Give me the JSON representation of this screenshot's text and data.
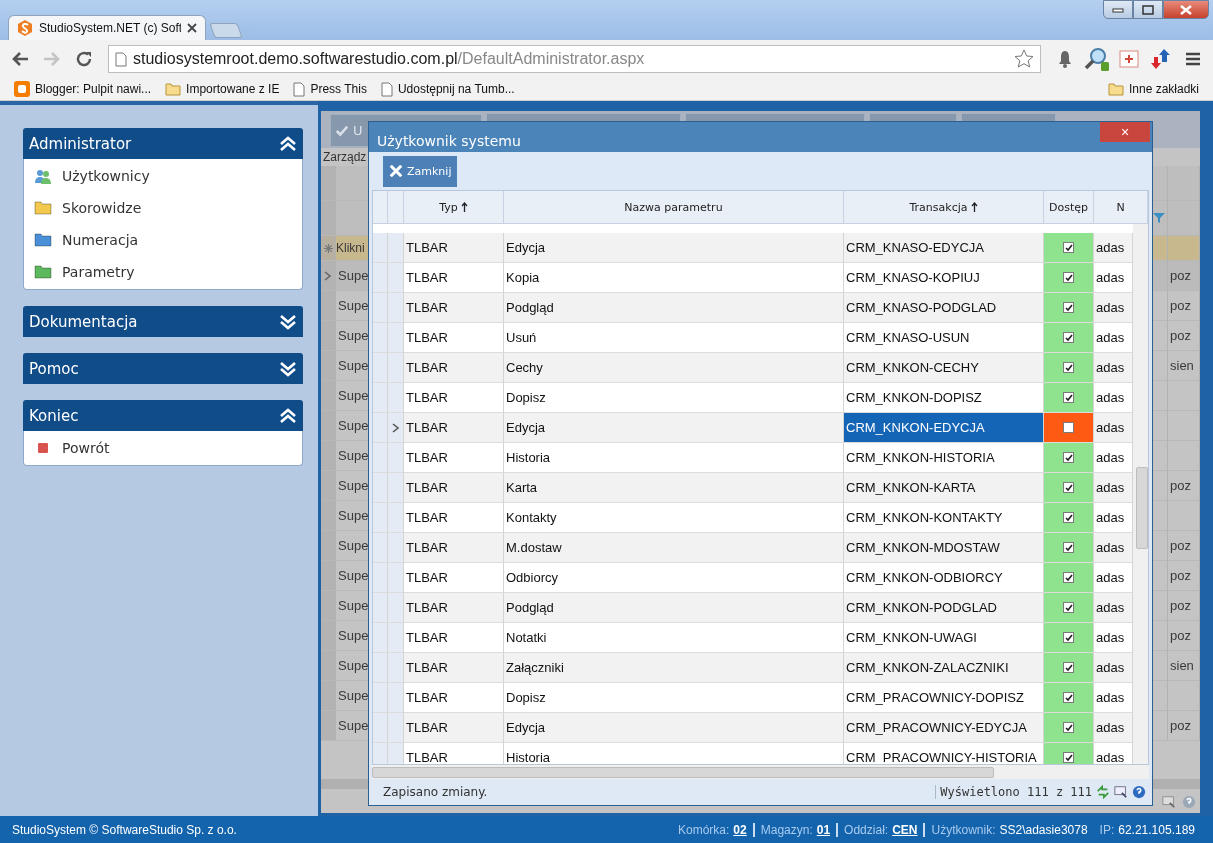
{
  "browser": {
    "tab_title": "StudioSystem.NET (c) Soft",
    "url_host": "studiosystemroot.demo.softwarestudio.com.pl",
    "url_path": "/DefaultAdministrator.aspx",
    "forward_disabled": true,
    "bookmarks": [
      {
        "label": "Blogger: Pulpit nawi...",
        "kind": "blogger"
      },
      {
        "label": "Importowane z IE",
        "kind": "folder"
      },
      {
        "label": "Press This",
        "kind": "page"
      },
      {
        "label": "Udostępnij na Tumb...",
        "kind": "page"
      }
    ],
    "other_bookmarks": "Inne zakładki"
  },
  "sidebar": {
    "panels": [
      {
        "title": "Administrator",
        "expanded": true,
        "items": [
          {
            "label": "Użytkownicy",
            "kind": "users"
          },
          {
            "label": "Skorowidze",
            "kind": "folder",
            "color": "#f2c94c"
          },
          {
            "label": "Numeracja",
            "kind": "folder",
            "color": "#4a90d9"
          },
          {
            "label": "Parametry",
            "kind": "folder",
            "color": "#5cb85c"
          }
        ]
      },
      {
        "title": "Dokumentacja",
        "expanded": false
      },
      {
        "title": "Pomoc",
        "expanded": false
      },
      {
        "title": "Koniec",
        "expanded": true,
        "items": [
          {
            "label": "Powrót",
            "kind": "square",
            "color": "#d9534f"
          }
        ]
      }
    ]
  },
  "background_grid": {
    "toolbar_button": "U",
    "section_label": "Zarządz",
    "new_row_hint": "Klikni",
    "rows": [
      {
        "column_1": "Supe",
        "column_2": "poz",
        "selected": true
      },
      {
        "column_1": "Supe",
        "column_2": "poz",
        "selected": false
      },
      {
        "column_1": "Supe",
        "column_2": "poz",
        "selected": false
      },
      {
        "column_1": "Supe",
        "column_2": "sien",
        "selected": false
      },
      {
        "column_1": "Supe",
        "selected": false
      },
      {
        "column_1": "Supe",
        "selected": false
      },
      {
        "column_1": "Supe",
        "selected": false
      },
      {
        "column_1": "Supe",
        "column_2": "poz",
        "selected": false
      },
      {
        "column_1": "Supe",
        "selected": false
      },
      {
        "column_1": "Supe",
        "column_2": "poz",
        "selected": false
      },
      {
        "column_1": "Supe",
        "column_2": "poz",
        "selected": false
      },
      {
        "column_1": "Supe",
        "column_2": "poz",
        "selected": false
      },
      {
        "column_1": "Supe",
        "column_2": "poz",
        "selected": false
      },
      {
        "column_1": "Supe",
        "column_2": "sien",
        "selected": false
      },
      {
        "column_1": "Supe",
        "selected": false
      },
      {
        "column_1": "Supe",
        "column_2": "poz",
        "selected": false
      }
    ]
  },
  "dialog": {
    "title": "Użytkownik systemu",
    "close_button": "×",
    "toolbar_button": "Zamknij",
    "columns": [
      {
        "label": "Typ",
        "sorted": true
      },
      {
        "label": "Nazwa parametru",
        "sorted": false
      },
      {
        "label": "Transakcja",
        "sorted": true
      },
      {
        "label": "Dostęp",
        "sorted": false
      },
      {
        "label": "N",
        "sorted": false
      }
    ],
    "rows": [
      {
        "typ": "TLBAR",
        "nazwa_parametru": "Edycja",
        "transakcja": "CRM_KNASO-EDYCJA",
        "dostep": true,
        "column_5": "adas",
        "selected": false
      },
      {
        "typ": "TLBAR",
        "nazwa_parametru": "Kopia",
        "transakcja": "CRM_KNASO-KOPIUJ",
        "dostep": true,
        "column_5": "adas",
        "selected": false
      },
      {
        "typ": "TLBAR",
        "nazwa_parametru": "Podgląd",
        "transakcja": "CRM_KNASO-PODGLAD",
        "dostep": true,
        "column_5": "adas",
        "selected": false
      },
      {
        "typ": "TLBAR",
        "nazwa_parametru": "Usuń",
        "transakcja": "CRM_KNASO-USUN",
        "dostep": true,
        "column_5": "adas",
        "selected": false
      },
      {
        "typ": "TLBAR",
        "nazwa_parametru": "Cechy",
        "transakcja": "CRM_KNKON-CECHY",
        "dostep": true,
        "column_5": "adas",
        "selected": false
      },
      {
        "typ": "TLBAR",
        "nazwa_parametru": "Dopisz",
        "transakcja": "CRM_KNKON-DOPISZ",
        "dostep": true,
        "column_5": "adas",
        "selected": false
      },
      {
        "typ": "TLBAR",
        "nazwa_parametru": "Edycja",
        "transakcja": "CRM_KNKON-EDYCJA",
        "dostep": false,
        "column_5": "adas",
        "selected": true
      },
      {
        "typ": "TLBAR",
        "nazwa_parametru": "Historia",
        "transakcja": "CRM_KNKON-HISTORIA",
        "dostep": true,
        "column_5": "adas",
        "selected": false
      },
      {
        "typ": "TLBAR",
        "nazwa_parametru": "Karta",
        "transakcja": "CRM_KNKON-KARTA",
        "dostep": true,
        "column_5": "adas",
        "selected": false
      },
      {
        "typ": "TLBAR",
        "nazwa_parametru": "Kontakty",
        "transakcja": "CRM_KNKON-KONTAKTY",
        "dostep": true,
        "column_5": "adas",
        "selected": false
      },
      {
        "typ": "TLBAR",
        "nazwa_parametru": "M.dostaw",
        "transakcja": "CRM_KNKON-MDOSTAW",
        "dostep": true,
        "column_5": "adas",
        "selected": false
      },
      {
        "typ": "TLBAR",
        "nazwa_parametru": "Odbiorcy",
        "transakcja": "CRM_KNKON-ODBIORCY",
        "dostep": true,
        "column_5": "adas",
        "selected": false
      },
      {
        "typ": "TLBAR",
        "nazwa_parametru": "Podgląd",
        "transakcja": "CRM_KNKON-PODGLAD",
        "dostep": true,
        "column_5": "adas",
        "selected": false
      },
      {
        "typ": "TLBAR",
        "nazwa_parametru": "Notatki",
        "transakcja": "CRM_KNKON-UWAGI",
        "dostep": true,
        "column_5": "adas",
        "selected": false
      },
      {
        "typ": "TLBAR",
        "nazwa_parametru": "Załączniki",
        "transakcja": "CRM_KNKON-ZALACZNIKI",
        "dostep": true,
        "column_5": "adas",
        "selected": false
      },
      {
        "typ": "TLBAR",
        "nazwa_parametru": "Dopisz",
        "transakcja": "CRM_PRACOWNICY-DOPISZ",
        "dostep": true,
        "column_5": "adas",
        "selected": false
      },
      {
        "typ": "TLBAR",
        "nazwa_parametru": "Edycja",
        "transakcja": "CRM_PRACOWNICY-EDYCJA",
        "dostep": true,
        "column_5": "adas",
        "selected": false
      },
      {
        "typ": "TLBAR",
        "nazwa_parametru": "Historia",
        "transakcja": "CRM_PRACOWNICY-HISTORIA",
        "dostep": true,
        "column_5": "adas",
        "selected": false
      }
    ],
    "status": "Zapisano zmiany.",
    "count": "Wyświetlono 111 z 111"
  },
  "footer": {
    "copyright": "StudioSystem © SoftwareStudio Sp. z o.o.",
    "fields": [
      {
        "label": "Komórka:",
        "value": "02",
        "link": true,
        "divided": false
      },
      {
        "label": "Magazyn:",
        "value": "01",
        "link": true,
        "divided": true
      },
      {
        "label": "Oddział:",
        "value": "CEN",
        "link": true,
        "divided": true
      },
      {
        "label": "Użytkownik:",
        "value": "SS2\\adasie3078",
        "link": false,
        "divided": true
      },
      {
        "label": "IP:",
        "value": "62.21.105.189",
        "link": false,
        "divided": false
      }
    ]
  }
}
